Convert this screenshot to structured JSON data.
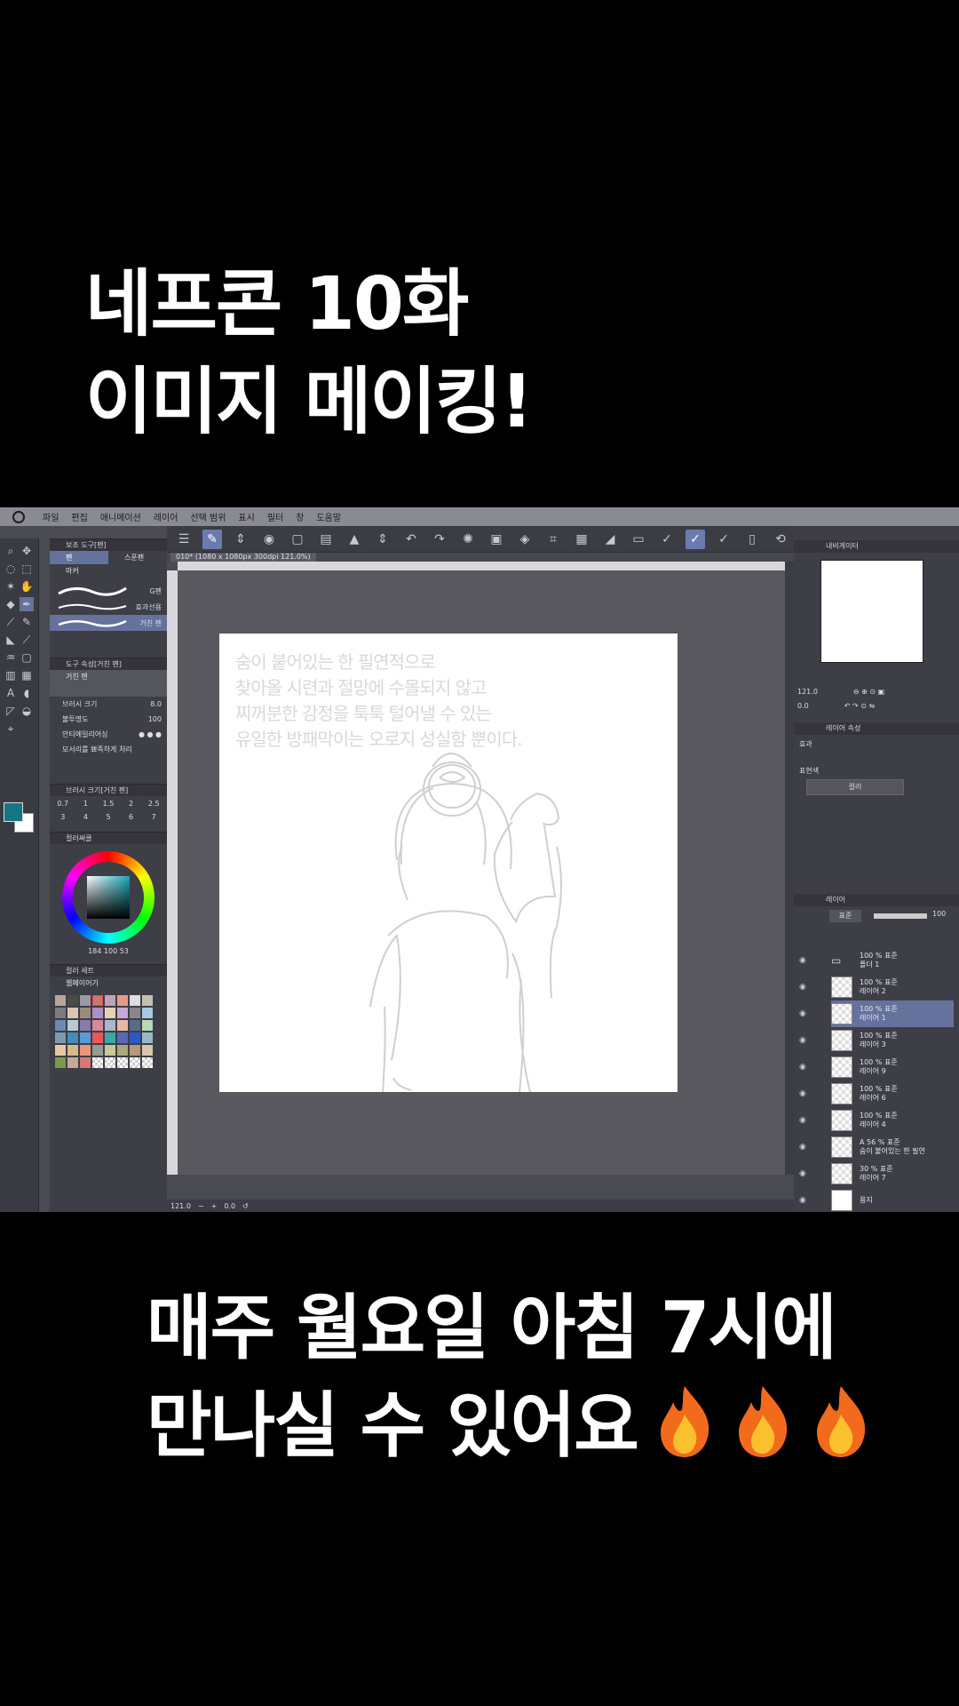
{
  "headline": {
    "line1": "네프콘 10화",
    "line2": "이미지 메이킹!"
  },
  "footer": {
    "line1": "매주 월요일 아침 7시에",
    "line2": "만나실 수 있어요"
  },
  "menu": [
    "파일",
    "편집",
    "애니메이션",
    "레이어",
    "선택 범위",
    "표시",
    "필터",
    "창",
    "도움말"
  ],
  "document_tab": "010* (1080 x 1080px 300dpi 121.0%)",
  "tool_panel": {
    "header": "보조 도구[펜]",
    "subtools": [
      "펜",
      "스푼펜",
      "마커"
    ],
    "brushes": [
      "G펜",
      "효과선용",
      "거친 펜"
    ],
    "tool_property_header": "도구 속성[거친 펜]",
    "tool_property_name": "거친 펜",
    "brush_size_label": "브러시 크기",
    "brush_size_value": "8.0",
    "opacity_label": "불투명도",
    "opacity_value": "100",
    "antialias_label": "안티에일리어싱",
    "corner_label": "모서리를 뾰족하게 처리",
    "brush_size_panel_header": "브러시 크기[거친 펜]",
    "sizes": [
      "0.7",
      "1",
      "1.5",
      "2",
      "2.5",
      "3",
      "4",
      "5",
      "6",
      "7"
    ],
    "color_wheel_header": "컬러써클",
    "color_values": "184 100 53",
    "color_set_header": "컬러 세트",
    "color_set_name": "웹페이어기"
  },
  "page_text": [
    "숨이 붙어있는 한 필연적으로",
    "찾아올 시련과 절망에 수몰되지 않고",
    "찌꺼분한 감정을 툭툭 털어낼 수 있는",
    "유일한 방패막이는 오로지 성실함 뿐이다."
  ],
  "status": {
    "zoom": "121.0",
    "angle": "0.0"
  },
  "right_panel": {
    "navigator_header": "내비게이터",
    "nav_zoom": "121.0",
    "nav_angle": "0.0",
    "layer_property_header": "레이어 속성",
    "effect_label": "효과",
    "expression_label": "표현색",
    "expression_value": "컬러",
    "layer_header": "레이어",
    "blend_mode": "표준",
    "opacity": "100",
    "layers": [
      {
        "pct": "100 %",
        "mode": "표준",
        "name": "폴더 1"
      },
      {
        "pct": "100 %",
        "mode": "표준",
        "name": "레이어 2"
      },
      {
        "pct": "100 %",
        "mode": "표준",
        "name": "레이어 1"
      },
      {
        "pct": "100 %",
        "mode": "표준",
        "name": "레이어 3"
      },
      {
        "pct": "100 %",
        "mode": "표준",
        "name": "레이어 9"
      },
      {
        "pct": "100 %",
        "mode": "표준",
        "name": "레이어 6"
      },
      {
        "pct": "100 %",
        "mode": "표준",
        "name": "레이어 4"
      },
      {
        "pct": "56 %",
        "mode": "표준",
        "name": "숨이 붙어있는 한 필연"
      },
      {
        "pct": "30 %",
        "mode": "표준",
        "name": "레이어 7"
      },
      {
        "pct": "",
        "mode": "",
        "name": "용지"
      }
    ]
  },
  "colors": {
    "main_color": "#157585",
    "selection": "#65729c",
    "panel_bg": "#3e3e46"
  }
}
